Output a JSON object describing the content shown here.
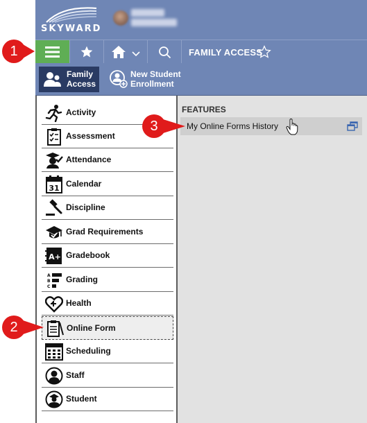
{
  "header": {
    "logo_text": "SKYWARD"
  },
  "toolbar": {
    "menu_icon": "hamburger-icon",
    "favorites_icon": "star-icon",
    "home_icon": "home-icon",
    "home_dropdown_icon": "chevron-down-icon",
    "search_icon": "search-icon",
    "title": "FAMILY ACCESS",
    "title_favorite_icon": "star-outline-icon"
  },
  "subnav": {
    "items": [
      {
        "label_line1": "Family",
        "label_line2": "Access",
        "icon": "family-icon",
        "selected": true
      },
      {
        "label_line1": "New Student",
        "label_line2": "Enrollment",
        "icon": "add-user-icon",
        "selected": false
      }
    ]
  },
  "sidebar": {
    "items": [
      {
        "label": "Activity",
        "icon": "runner-icon"
      },
      {
        "label": "Assessment",
        "icon": "clipboard-check-icon"
      },
      {
        "label": "Attendance",
        "icon": "attendance-icon"
      },
      {
        "label": "Calendar",
        "icon": "calendar-icon",
        "icon_text": "31"
      },
      {
        "label": "Discipline",
        "icon": "gavel-icon"
      },
      {
        "label": "Grad Requirements",
        "icon": "graduation-cap-icon"
      },
      {
        "label": "Gradebook",
        "icon": "gradebook-icon",
        "icon_text": "A+"
      },
      {
        "label": "Grading",
        "icon": "grading-list-icon",
        "icon_text_a": "A",
        "icon_text_b": "B",
        "icon_text_c": "C"
      },
      {
        "label": "Health",
        "icon": "health-heart-icon"
      },
      {
        "label": "Online Form",
        "icon": "online-form-icon",
        "selected": true
      },
      {
        "label": "Scheduling",
        "icon": "schedule-grid-icon"
      },
      {
        "label": "Staff",
        "icon": "staff-icon"
      },
      {
        "label": "Student",
        "icon": "student-icon"
      }
    ]
  },
  "content": {
    "heading": "FEATURES",
    "features": [
      {
        "label": "My Online Forms History",
        "icon": "popout-window-icon"
      }
    ]
  },
  "annotations": [
    {
      "number": "1"
    },
    {
      "number": "2"
    },
    {
      "number": "3"
    }
  ],
  "colors": {
    "header_blue": "#6f86b5",
    "menu_green": "#5fae55",
    "subnav_selected": "#2a3b63",
    "badge_red": "#e01b1b"
  }
}
